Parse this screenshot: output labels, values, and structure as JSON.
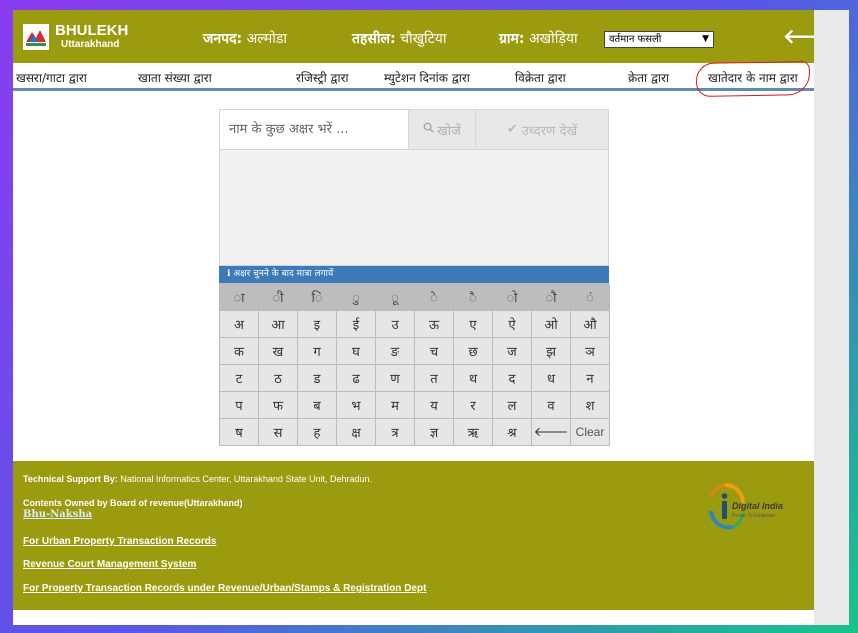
{
  "header": {
    "logo_title": "BHULEKH",
    "logo_subtitle": "Uttarakhand",
    "district_label": "जनपद:",
    "district_value": "अल्मोडा",
    "tehsil_label": "तहसील:",
    "tehsil_value": "चौखुटिया",
    "village_label": "ग्राम:",
    "village_value": "अखोड़िया",
    "season_select_value": "वर्तमान फसली",
    "back_icon": "arrow-left-icon"
  },
  "nav": {
    "items": [
      "खसरा/गाटा द्वारा",
      "खाता संख्या द्वारा",
      "रजिस्ट्री द्वारा",
      "म्युटेशन दिनांक द्वारा",
      "विक्रेता द्वारा",
      "क्रेता द्वारा",
      "खातेदार के नाम द्वारा"
    ],
    "highlighted_item_color": "#d81b1b"
  },
  "search": {
    "placeholder": "नाम के कुछ अक्षर भरें ...",
    "search_button": "खोजें",
    "search_icon": "search-icon",
    "view_button": "उध्दरण देखें",
    "view_icon": "check-icon"
  },
  "keyboard": {
    "hint_icon": "info-icon",
    "hint": "अक्षर चुनने के बाद मात्रा लगायें",
    "matras": [
      "ा",
      "ी",
      "ि",
      "ु",
      "ू",
      "े",
      "ै",
      "ो",
      "ौ",
      "ं"
    ],
    "vowels": [
      "अ",
      "आ",
      "इ",
      "ई",
      "उ",
      "ऊ",
      "ए",
      "ऐ",
      "ओ",
      "औ"
    ],
    "row3": [
      "क",
      "ख",
      "ग",
      "घ",
      "ङ",
      "च",
      "छ",
      "ज",
      "झ",
      "ञ"
    ],
    "row4": [
      "ट",
      "ठ",
      "ड",
      "ढ",
      "ण",
      "त",
      "थ",
      "द",
      "ध",
      "न"
    ],
    "row5": [
      "प",
      "फ",
      "ब",
      "भ",
      "म",
      "य",
      "र",
      "ल",
      "व",
      "श"
    ],
    "row6": [
      "ष",
      "स",
      "ह",
      "क्ष",
      "त्र",
      "ज्ञ",
      "ऋ",
      "श्र",
      "🡐",
      "Clear"
    ]
  },
  "footer": {
    "tech_support_label": "Technical Support By:",
    "tech_support_value": "National Informatics Center, Uttarakhand State Unit, Dehradun.",
    "owned_by": "Contents Owned by Board of revenue(Uttarakhand)",
    "bhu_naksha": "Bhu-Naksha",
    "links": [
      "For Urban Property Transaction Records",
      "Revenue Court Management System",
      "For Property Transaction Records under Revenue/Urban/Stamps & Registration Dept"
    ],
    "digital_india": "Digital India",
    "digital_india_tagline": "Power To Empower"
  },
  "colors": {
    "header_bg": "#9b9b0f",
    "hint_bar": "#3c7ab8",
    "nav_underline": "#5f8bb5"
  }
}
